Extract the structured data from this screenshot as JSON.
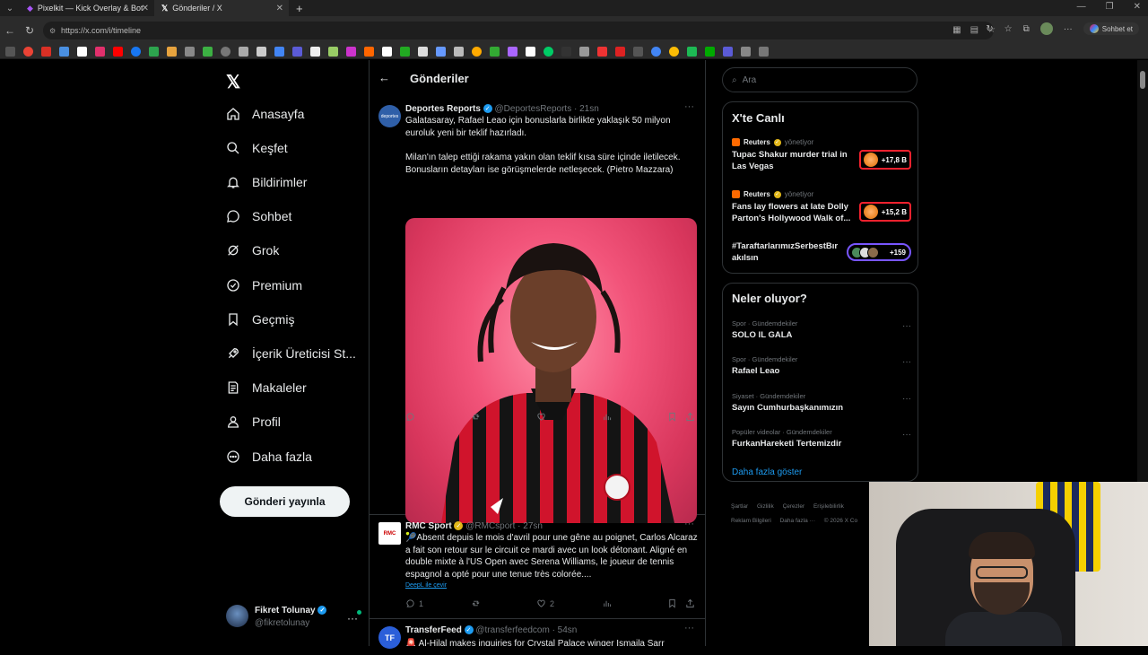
{
  "browser": {
    "tabs": [
      {
        "title": "Pixelkit — Kick Overlay & Bot",
        "active": false
      },
      {
        "title": "Gönderiler / X",
        "active": true
      }
    ],
    "url": "https://x.com/i/timeline",
    "sohbet_label": "Sohbet et"
  },
  "nav": {
    "items": [
      {
        "label": "Anasayfa",
        "icon": "home-icon"
      },
      {
        "label": "Keşfet",
        "icon": "search-icon"
      },
      {
        "label": "Bildirimler",
        "icon": "bell-icon"
      },
      {
        "label": "Sohbet",
        "icon": "chat-icon"
      },
      {
        "label": "Grok",
        "icon": "grok-icon"
      },
      {
        "label": "Premium",
        "icon": "premium-icon"
      },
      {
        "label": "Geçmiş",
        "icon": "bookmark-icon"
      },
      {
        "label": "İçerik Üreticisi St...",
        "icon": "rocket-icon"
      },
      {
        "label": "Makaleler",
        "icon": "article-icon"
      },
      {
        "label": "Profil",
        "icon": "person-icon"
      },
      {
        "label": "Daha fazla",
        "icon": "more-circle-icon"
      }
    ],
    "post_button": "Gönderi yayınla",
    "profile": {
      "name": "Fikret Tolunay",
      "handle": "@fikretolunay"
    }
  },
  "timeline": {
    "title": "Gönderiler",
    "tweets": [
      {
        "name": "Deportes Reports",
        "handle": "@DeportesReports",
        "time": "· 21sn",
        "avatar_text": "deportes",
        "text1": "Galatasaray, Rafael Leao için bonuslarla birlikte yaklaşık 50 milyon euroluk yeni bir teklif hazırladı.",
        "text2": "Milan'ın talep ettiği rakama yakın olan teklif kısa süre içinde iletilecek. Bonusların detayları ise görüşmelerde netleşecek. (Pietro Mazzara)"
      },
      {
        "name": "RMC Sport",
        "handle": "@RMCsport",
        "time": "· 27sn",
        "avatar_text": "RMC",
        "text1": "🎾Absent depuis le mois d'avril pour une gêne au poignet, Carlos Alcaraz a fait son retour sur le circuit ce mardi avec un look détonant. Aligné en double mixte à l'US Open avec Serena Williams, le joueur de tennis espagnol a opté pour une tenue très colorée....",
        "translate": "DeepL ile çevir",
        "replies": "1",
        "likes": "2"
      },
      {
        "name": "TransferFeed",
        "handle": "@transferfeedcom",
        "time": "· 54sn",
        "avatar_text": "TF",
        "text1": "🚨 Al-Hilal makes inquiries for Crystal Palace winger Ismaila Sarr"
      }
    ]
  },
  "right": {
    "search_placeholder": "Ara",
    "live": {
      "title": "X'te Canlı",
      "items": [
        {
          "source": "Reuters",
          "status": "yönetiyor",
          "title": "Tupac Shakur murder trial in Las Vegas",
          "count": "+17,8 B"
        },
        {
          "source": "Reuters",
          "status": "yönetiyor",
          "title": "Fans lay flowers at late Dolly Parton's Hollywood Walk of...",
          "count": "+15,2 B"
        },
        {
          "title": "#TaraftarlarımızSerbestBırakılsın",
          "count": "+159"
        }
      ]
    },
    "trends": {
      "title": "Neler oluyor?",
      "items": [
        {
          "meta": "Spor · Gündemdekiler",
          "label": "SOLO IL GALA"
        },
        {
          "meta": "Spor · Gündemdekiler",
          "label": "Rafael Leao"
        },
        {
          "meta": "Siyaset · Gündemdekiler",
          "label": "Sayın Cumhurbaşkanımızın"
        },
        {
          "meta": "Popüler videolar · Gündemdekiler",
          "label": "FurkanHareketi Tertemizdir"
        }
      ],
      "show_more": "Daha fazla göster"
    },
    "footer": [
      "Şartlar",
      "Gizlilik",
      "Çerezler",
      "Erişilebilirlik",
      "Reklam Bilgileri",
      "Daha fazla ···",
      "© 2026 X Co"
    ]
  },
  "colors": {
    "accent": "#1d9bf0",
    "live_red": "#f4212e",
    "live_purple": "#7856ff",
    "verified_gold": "#e2b719"
  }
}
